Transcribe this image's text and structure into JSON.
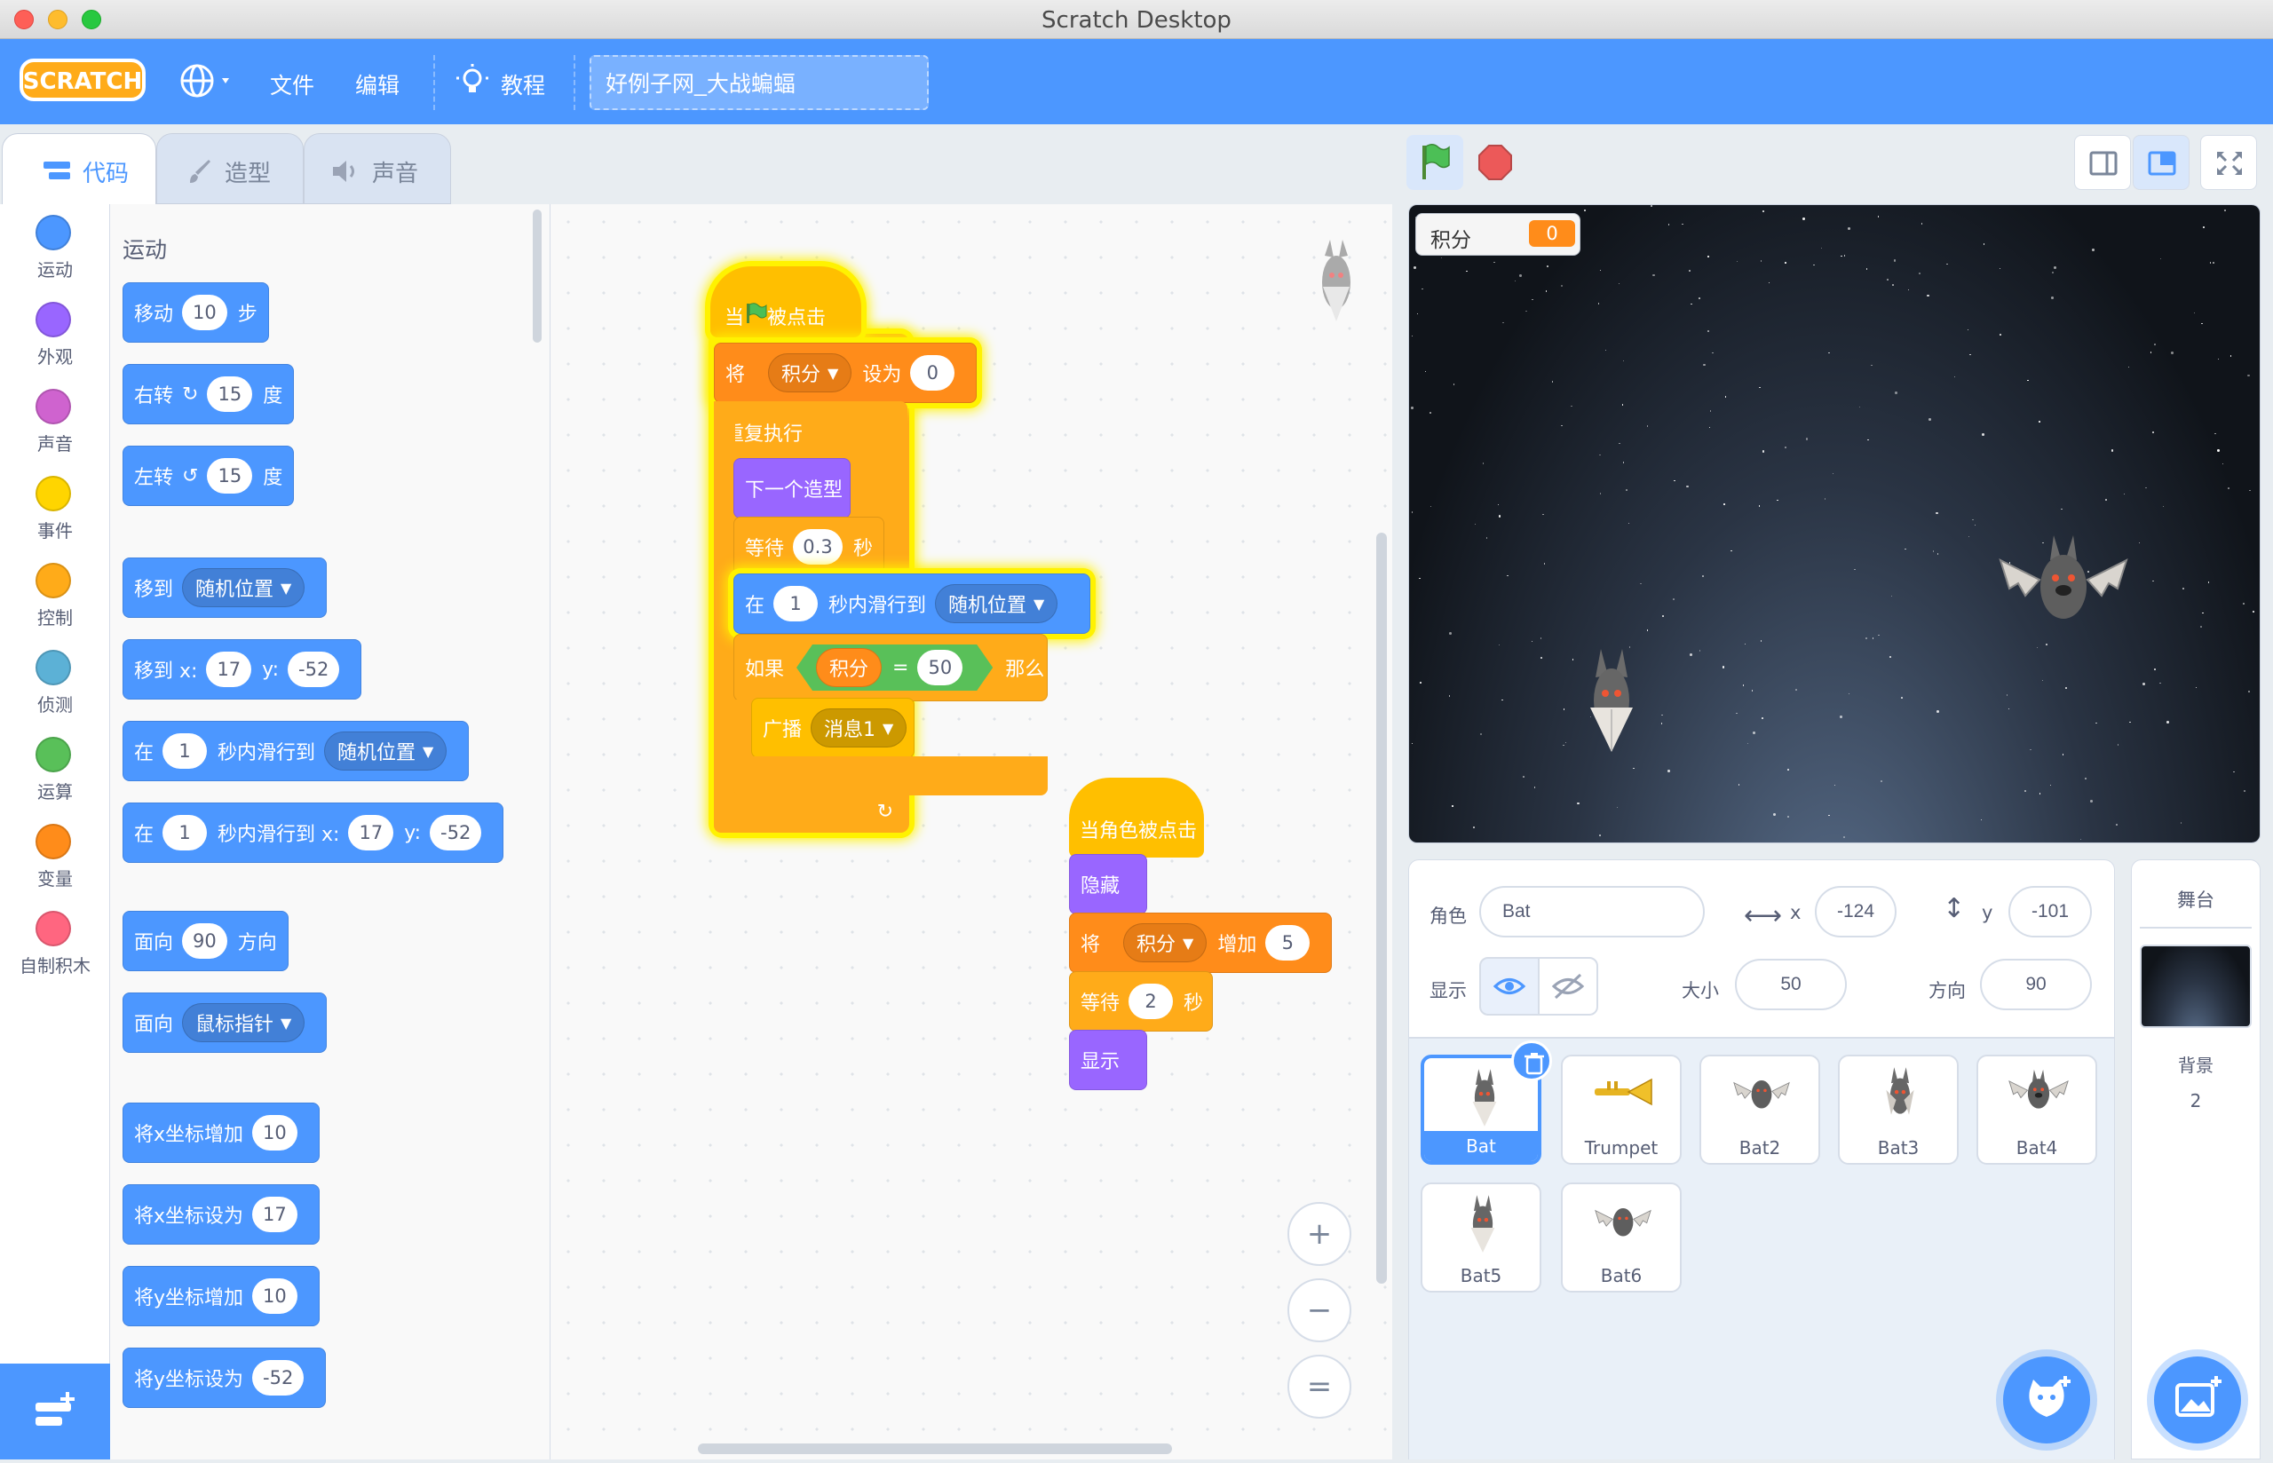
{
  "window": {
    "title": "Scratch Desktop"
  },
  "menubar": {
    "logo": "SCRATCH",
    "file": "文件",
    "edit": "编辑",
    "tutorials": "教程",
    "project_title": "好例子网_大战蝙蝠"
  },
  "tabs": {
    "code": "代码",
    "costumes": "造型",
    "sounds": "声音"
  },
  "categories": [
    {
      "label": "运动",
      "color": "#4c97ff"
    },
    {
      "label": "外观",
      "color": "#9966ff"
    },
    {
      "label": "声音",
      "color": "#cf63cf"
    },
    {
      "label": "事件",
      "color": "#ffd500"
    },
    {
      "label": "控制",
      "color": "#ffab19"
    },
    {
      "label": "侦测",
      "color": "#5cb1d6"
    },
    {
      "label": "运算",
      "color": "#59c059"
    },
    {
      "label": "变量",
      "color": "#ff8c1a"
    },
    {
      "label": "自制积木",
      "color": "#ff6680"
    }
  ],
  "palette": {
    "title": "运动",
    "move": {
      "a": "移动",
      "n": "10",
      "b": "步"
    },
    "turn_right": {
      "a": "右转",
      "n": "15",
      "b": "度"
    },
    "turn_left": {
      "a": "左转",
      "n": "15",
      "b": "度"
    },
    "goto": {
      "a": "移到",
      "menu": "随机位置"
    },
    "goto_xy": {
      "a": "移到 x:",
      "x": "17",
      "b": "y:",
      "y": "-52"
    },
    "glide": {
      "a": "在",
      "n": "1",
      "b": "秒内滑行到",
      "menu": "随机位置"
    },
    "glide_xy": {
      "a": "在",
      "n": "1",
      "b": "秒内滑行到 x:",
      "x": "17",
      "c": "y:",
      "y": "-52"
    },
    "point_dir": {
      "a": "面向",
      "n": "90",
      "b": "方向"
    },
    "point_towards": {
      "a": "面向",
      "menu": "鼠标指针"
    },
    "change_x": {
      "a": "将x坐标增加",
      "n": "10"
    },
    "set_x": {
      "a": "将x坐标设为",
      "n": "17"
    },
    "change_y": {
      "a": "将y坐标增加",
      "n": "10"
    },
    "set_y": {
      "a": "将y坐标设为",
      "n": "-52"
    }
  },
  "script1": {
    "hat": {
      "a": "当",
      "b": "被点击"
    },
    "set_var": {
      "a": "将",
      "var": "积分",
      "b": "设为",
      "n": "0"
    },
    "forever": "重复执行",
    "next_costume": "下一个造型",
    "wait": {
      "a": "等待",
      "n": "0.3",
      "b": "秒"
    },
    "glide": {
      "a": "在",
      "n": "1",
      "b": "秒内滑行到",
      "menu": "随机位置"
    },
    "if": {
      "a": "如果",
      "var": "积分",
      "op": "=",
      "n": "50",
      "b": "那么"
    },
    "broadcast": {
      "a": "广播",
      "menu": "消息1"
    }
  },
  "script2": {
    "hat": "当角色被点击",
    "hide": "隐藏",
    "change_var": {
      "a": "将",
      "var": "积分",
      "b": "增加",
      "n": "5"
    },
    "wait": {
      "a": "等待",
      "n": "2",
      "b": "秒"
    },
    "show": "显示"
  },
  "zoom": {
    "in": "+",
    "out": "−",
    "reset": "="
  },
  "monitor": {
    "label": "积分",
    "value": "0"
  },
  "sprite_info": {
    "sprite_label": "角色",
    "sprite_name": "Bat",
    "x_label": "x",
    "x": "-124",
    "y_label": "y",
    "y": "-101",
    "show_label": "显示",
    "size_label": "大小",
    "size": "50",
    "direction_label": "方向",
    "direction": "90"
  },
  "sprites": [
    "Bat",
    "Trumpet",
    "Bat2",
    "Bat3",
    "Bat4",
    "Bat5",
    "Bat6"
  ],
  "stage_pane": {
    "title": "舞台",
    "backdrops_label": "背景",
    "backdrops_count": "2"
  },
  "colors": {
    "accent": "#4c97ff",
    "menubar": "#4c97ff",
    "glow": "#fff200"
  }
}
